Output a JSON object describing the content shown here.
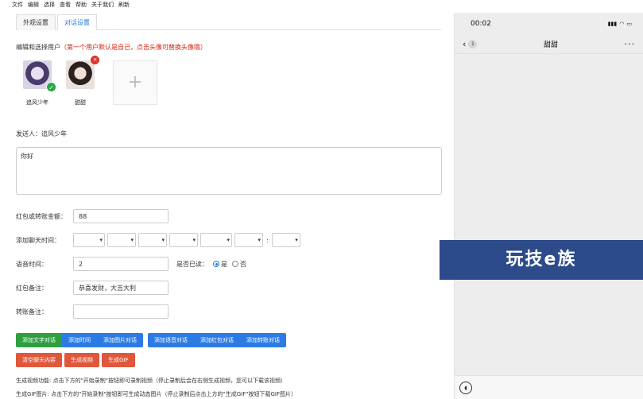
{
  "menu": [
    "文件",
    "编辑",
    "选择",
    "查看",
    "帮助",
    "关于我们",
    "刷新"
  ],
  "tabs": [
    {
      "label": "外观设置",
      "active": false
    },
    {
      "label": "对话设置",
      "active": true
    }
  ],
  "user_hint": {
    "label": "编辑和选择用户",
    "note": "（第一个用户默认是自己，点击头像可替换头像哦）"
  },
  "users": [
    {
      "name": "追风少年",
      "selected": true
    },
    {
      "name": "甜甜",
      "removable": true
    }
  ],
  "add_user_symbol": "+",
  "sender": "发送人：追风少年",
  "message": "你好",
  "fields": {
    "amount_label": "红包或转账金额：",
    "amount_value": "88",
    "time_label": "添加聊天时间：",
    "voice_label": "语音时间：",
    "voice_value": "2",
    "read_label": "是否已读：",
    "read_yes": "是",
    "read_no": "否",
    "redpack_note_label": "红包备注：",
    "redpack_note_value": "恭喜发财，大吉大利",
    "transfer_note_label": "转账备注："
  },
  "time_colon": ":",
  "buttons": {
    "group1": [
      "添加文字对话",
      "添加时间",
      "添加图片对话"
    ],
    "group2": [
      "添加语音对话",
      "添加红包对话",
      "添加转账对话"
    ],
    "group3": [
      "清空聊天内容",
      "生成视频",
      "生成GIF"
    ]
  },
  "descriptions": [
    "生成视频功能: 点击下方的\"开始录制\"按钮即可录制视频（停止录制后会在右侧生成视频，您可以下载该视频）",
    "生成GIF图片: 点击下方的\"开始录制\"按钮即可生成动态图片（停止录制后点击上方的\"生成GIF\"按钮下载GIF图片）"
  ],
  "phone": {
    "time": "00:02",
    "back_count": "1",
    "title": "甜甜",
    "more": "···"
  },
  "watermark": "玩技e族"
}
